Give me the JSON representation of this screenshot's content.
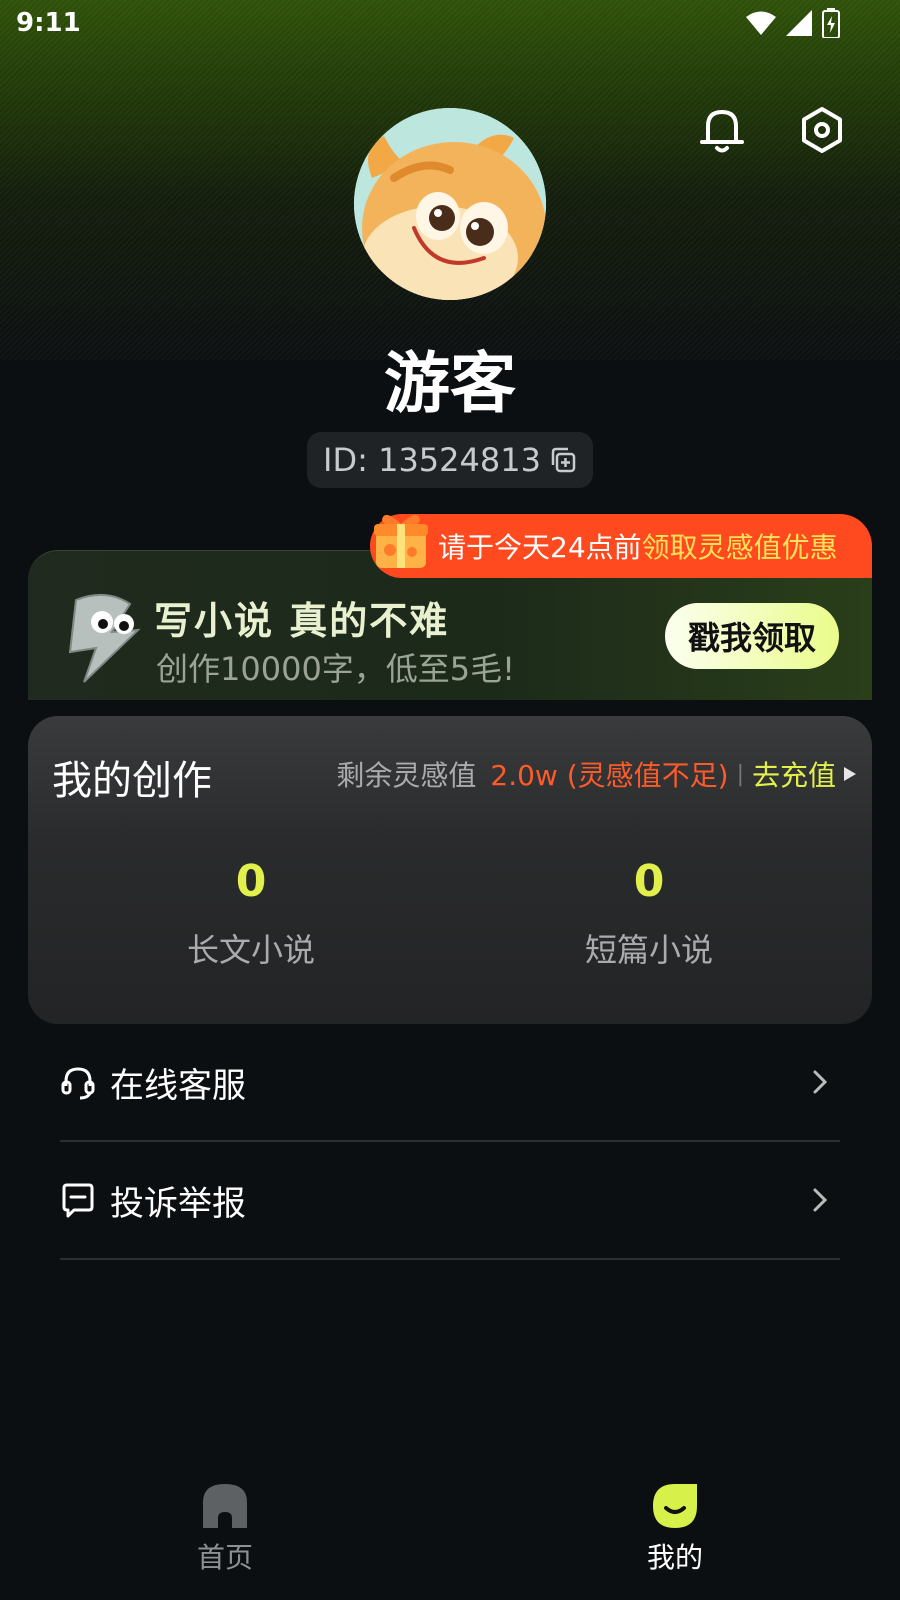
{
  "status_bar": {
    "time": "9:11"
  },
  "profile": {
    "name": "游客",
    "id_text": "ID: 13524813"
  },
  "promo": {
    "tag_text": "请于今天24点前",
    "tag_highlight": "领取灵感值优惠",
    "title": "写小说 真的不难",
    "subtitle": "创作10000字，低至5毛!",
    "button": "戳我领取"
  },
  "creation": {
    "title": "我的创作",
    "remain_label": "剩余灵感值",
    "remain_value": "2.0w (灵感值不足)",
    "recharge": "去充值",
    "stats": [
      {
        "value": "0",
        "label": "长文小说"
      },
      {
        "value": "0",
        "label": "短篇小说"
      }
    ]
  },
  "menu": [
    {
      "label": "在线客服",
      "icon": "headset-icon"
    },
    {
      "label": "投诉举报",
      "icon": "message-icon"
    }
  ],
  "tabbar": [
    {
      "label": "首页",
      "icon": "home-icon"
    },
    {
      "label": "我的",
      "icon": "smile-icon"
    }
  ],
  "colors": {
    "accent_yellow": "#e2f04c",
    "warning_orange": "#ff5a2a",
    "promo_tag": "#ff4a1f",
    "background": "#0b0f11"
  }
}
